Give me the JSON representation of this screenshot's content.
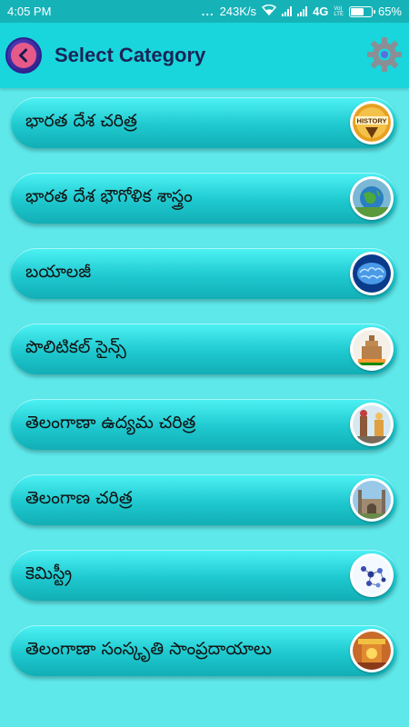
{
  "status_bar": {
    "time": "4:05 PM",
    "dots": "...",
    "network_speed": "243K/s",
    "network_type": "4G",
    "volte_top": "Vo)",
    "volte_bottom": "LTE",
    "battery": "65%",
    "battery_level": 0.65
  },
  "header": {
    "title": "Select Category",
    "back_icon": "back-arrow-icon",
    "settings_icon": "gear-icon"
  },
  "colors": {
    "background": "#5ee8ea",
    "header": "#18d6dc",
    "status_bar": "#15b3b8",
    "title": "#1a2457"
  },
  "categories": [
    {
      "label": "భారత దేశ చరిత్ర",
      "icon": "history-icon",
      "thumb_text": "HISTORY"
    },
    {
      "label": "భారత దేశ భౌగోళిక శాస్త్రం",
      "icon": "globe-icon"
    },
    {
      "label": "బయాలజీ",
      "icon": "brain-icon"
    },
    {
      "label": "పొలిటికల్ సైన్స్",
      "icon": "parliament-icon"
    },
    {
      "label": "తెలంగాణా ఉద్యమ చరిత్ర",
      "icon": "statue-icon"
    },
    {
      "label": "తెలంగాణ చరిత్ర",
      "icon": "charminar-icon"
    },
    {
      "label": "కెమిస్ట్రీ",
      "icon": "molecule-icon"
    },
    {
      "label": "తెలంగాణా సంస్కృతి సాంప్రదాయాలు",
      "icon": "culture-icon"
    }
  ]
}
